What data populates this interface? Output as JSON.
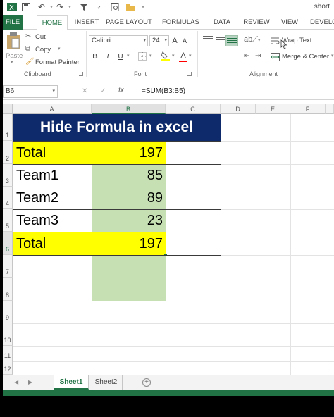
{
  "window": {
    "title": "short"
  },
  "tabs": [
    "FILE",
    "HOME",
    "INSERT",
    "PAGE LAYOUT",
    "FORMULAS",
    "DATA",
    "REVIEW",
    "VIEW",
    "DEVELO"
  ],
  "clipboard": {
    "paste": "Paste",
    "cut": "Cut",
    "copy": "Copy",
    "format_painter": "Format Painter",
    "label": "Clipboard"
  },
  "font": {
    "name": "Calibri",
    "size": "24",
    "bold": "B",
    "italic": "I",
    "underline": "U",
    "grow": "A",
    "shrink": "A",
    "color_letter": "A",
    "label": "Font"
  },
  "alignment": {
    "wrap_text": "Wrap Text",
    "merge_center": "Merge & Center",
    "label": "Alignment"
  },
  "formula_bar": {
    "name_box": "B6",
    "cancel": "✕",
    "enter": "✓",
    "fx": "fx",
    "formula": "=SUM(B3:B5)"
  },
  "columns": [
    "A",
    "B",
    "C",
    "D",
    "E",
    "F"
  ],
  "rows": [
    "1",
    "2",
    "3",
    "4",
    "5",
    "6",
    "7",
    "8",
    "9",
    "10",
    "11",
    "12"
  ],
  "sheet": {
    "title": "Hide Formula in excel",
    "rows": [
      {
        "label": "Total",
        "value": "197"
      },
      {
        "label": "Team1",
        "value": "85"
      },
      {
        "label": "Team2",
        "value": "89"
      },
      {
        "label": "Team3",
        "value": "23"
      },
      {
        "label": "Total",
        "value": "197"
      }
    ]
  },
  "sheet_tabs": [
    "Sheet1",
    "Sheet2"
  ],
  "colors": {
    "excel_green": "#217346",
    "title_fill": "#0e2a6b",
    "highlight": "#ffff00",
    "selection": "#c6e0b4"
  }
}
